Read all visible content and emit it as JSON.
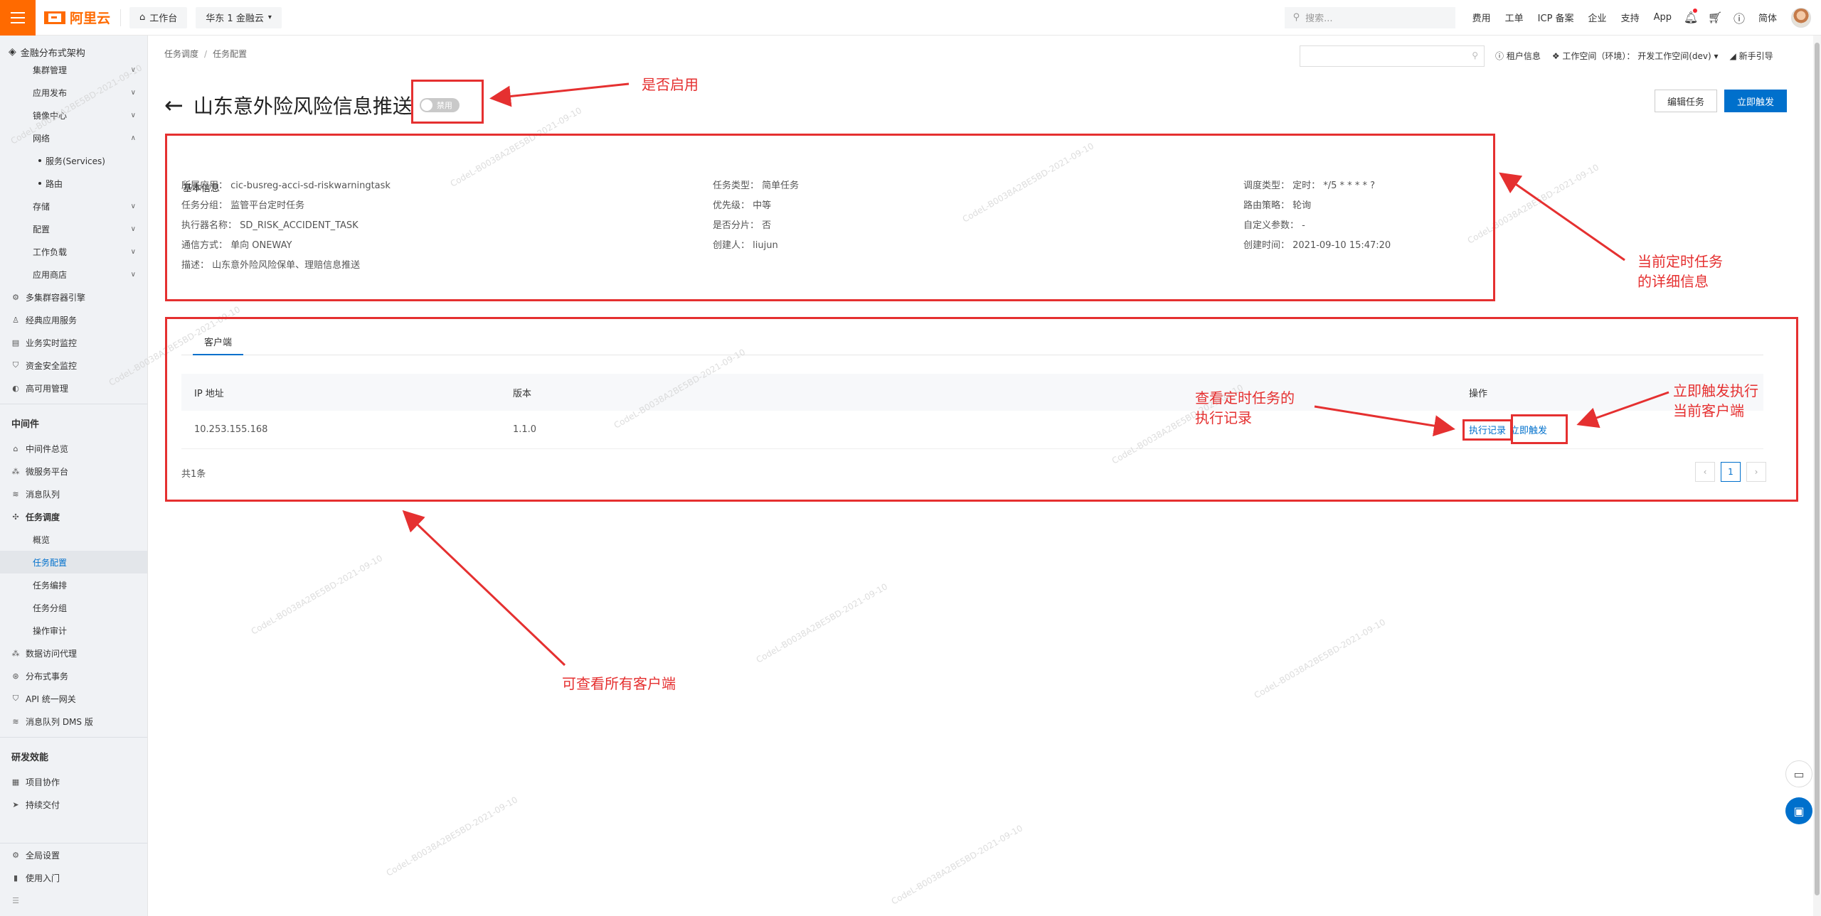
{
  "topbar": {
    "logo_text": "阿里云",
    "workbench": "工作台",
    "region": "华东 1 金融云",
    "search_placeholder": "搜索...",
    "links": [
      "费用",
      "工单",
      "ICP 备案",
      "企业",
      "支持",
      "App"
    ],
    "lang": "简体"
  },
  "sidebar": {
    "title": "金融分布式架构",
    "cluster_items": [
      {
        "label": "集群管理"
      },
      {
        "label": "应用发布"
      },
      {
        "label": "镜像中心"
      },
      {
        "label": "网络"
      }
    ],
    "network_sub": [
      "服务(Services)",
      "路由"
    ],
    "cluster_items2": [
      {
        "label": "存储"
      },
      {
        "label": "配置"
      },
      {
        "label": "工作负载"
      },
      {
        "label": "应用商店"
      }
    ],
    "top_items": [
      "多集群容器引擎",
      "经典应用服务",
      "业务实时监控",
      "资金安全监控",
      "高可用管理"
    ],
    "middleware_header": "中间件",
    "middleware_items": [
      "中间件总览",
      "微服务平台",
      "消息队列"
    ],
    "task_sched": "任务调度",
    "task_sub": [
      "概览",
      "任务配置",
      "任务编排",
      "任务分组",
      "操作审计"
    ],
    "middleware_items2": [
      "数据访问代理",
      "分布式事务",
      "API 统一网关",
      "消息队列 DMS 版"
    ],
    "devops_header": "研发效能",
    "devops_items": [
      "项目协作",
      "持续交付"
    ],
    "bottom_items": [
      "全局设置",
      "使用入门"
    ]
  },
  "main": {
    "breadcrumb": [
      "任务调度",
      "任务配置"
    ],
    "context": {
      "tenant": "租户信息",
      "workspace": "工作空间（环境）： 开发工作空间(dev)",
      "guide": "新手引导"
    },
    "title": "山东意外险风险信息推送",
    "toggle_label": "禁用",
    "edit_button": "编辑任务",
    "trigger_button": "立即触发",
    "basic_info_title": "基本信息",
    "info": {
      "app": "所属应用： cic-busreg-acci-sd-riskwarningtask",
      "group": "任务分组： 监管平台定时任务",
      "executor": "执行器名称： SD_RISK_ACCIDENT_TASK",
      "comm": "通信方式： 单向 ONEWAY",
      "desc": "描述： 山东意外险风险保单、理赔信息推送",
      "task_type": "任务类型： 简单任务",
      "priority": "优先级： 中等",
      "sharding": "是否分片： 否",
      "creator": "创建人： liujun",
      "sched_type": "调度类型： 定时： */5 * * * * ?",
      "route": "路由策略： 轮询",
      "params": "自定义参数： -",
      "created": "创建时间： 2021-09-10 15:47:20"
    },
    "tab_label": "客户端",
    "table": {
      "headers": [
        "IP 地址",
        "版本",
        "操作"
      ],
      "rows": [
        {
          "ip": "10.253.155.168",
          "version": "1.1.0",
          "action1": "执行记录",
          "action2": "立即触发"
        }
      ]
    },
    "total": "共1条",
    "page": "1"
  },
  "annotations": {
    "enable": "是否启用",
    "detail": [
      "当前定时任务",
      "的详细信息"
    ],
    "exec_record": [
      "查看定时任务的",
      "执行记录"
    ],
    "trigger": [
      "立即触发执行",
      "当前客户端"
    ],
    "all_clients": "可查看所有客户端"
  },
  "colors": {
    "brand": "#ff6a00",
    "primary": "#0070cc",
    "annotation": "#e53030"
  }
}
